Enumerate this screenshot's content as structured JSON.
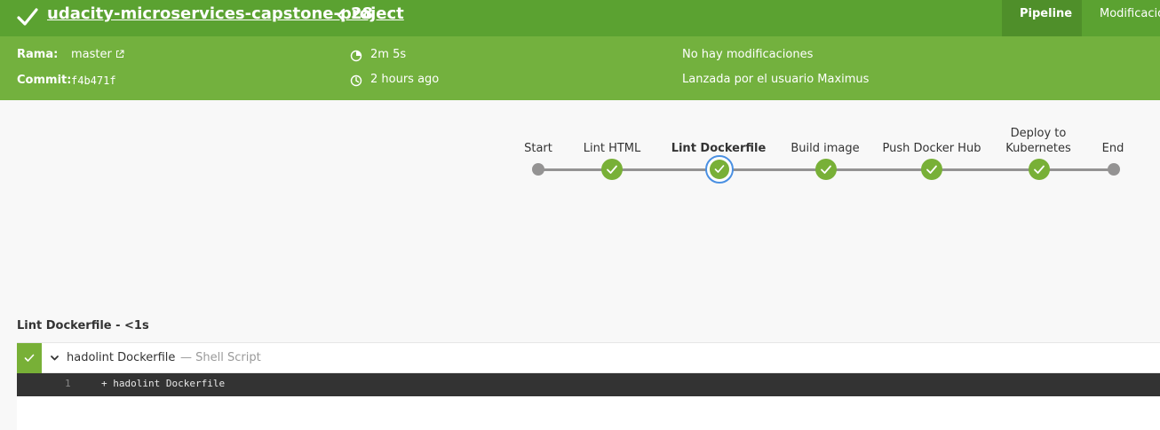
{
  "header": {
    "project_title": "udacity-microservices-capstone-project",
    "run_number": "28",
    "tabs": [
      {
        "label": "Pipeline",
        "active": true
      },
      {
        "label": "Modificaciones",
        "active": false
      }
    ],
    "status_icon": "check-icon",
    "colors": {
      "topbar": "#5ba231",
      "infobar": "#73b13e",
      "success": "#78b037",
      "selected": "#4a90e2"
    }
  },
  "info": {
    "branch_label": "Rama:",
    "branch_value": "master",
    "commit_label": "Commit:",
    "commit_value": "f4b471f",
    "duration": "2m 5s",
    "started": "2 hours ago",
    "changes": "No hay modificaciones",
    "trigger": "Lanzada por el usuario Maximus"
  },
  "pipeline": {
    "stages": [
      {
        "label": "Start",
        "status": "none"
      },
      {
        "label": "Lint HTML",
        "status": "success"
      },
      {
        "label": "Lint Dockerfile",
        "status": "success",
        "selected": true
      },
      {
        "label": "Build image",
        "status": "success"
      },
      {
        "label": "Push Docker Hub",
        "status": "success"
      },
      {
        "label": "Deploy to Kubernetes",
        "status": "success"
      },
      {
        "label": "End",
        "status": "none"
      }
    ]
  },
  "step_detail": {
    "title": "Lint Dockerfile - <1s",
    "step_name": "hadolint Dockerfile",
    "step_type": "— Shell Script",
    "log_lines": [
      {
        "no": "1",
        "text": "+ hadolint Dockerfile"
      }
    ]
  }
}
